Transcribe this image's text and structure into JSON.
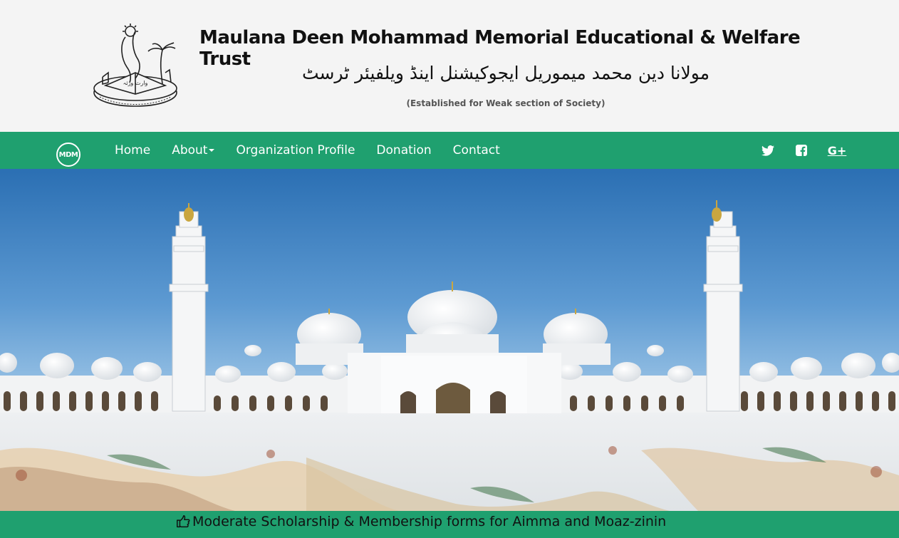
{
  "header": {
    "title": "Maulana Deen Mohammad Memorial Educational & Welfare Trust",
    "urdu_title": "مولانا دین محمد میموریل ایجوکیشنل اینڈ ویلفیئر ٹرسٹ",
    "subtitle": "(Established for Weak section of Society)",
    "logo_text": "وارث ورثہ"
  },
  "navbar": {
    "brand": "MDM",
    "items": [
      {
        "label": "Home"
      },
      {
        "label": "About"
      },
      {
        "label": "Organization Profile"
      },
      {
        "label": "Donation"
      },
      {
        "label": "Contact"
      }
    ],
    "social": [
      "twitter-icon",
      "facebook-icon",
      "google-plus-icon"
    ],
    "google_plus_label": "G+"
  },
  "hero": {
    "image": "mosque-photo"
  },
  "ticker": {
    "text": "Moderate Scholarship & Membership forms for Aimma and Moaz-zinin"
  },
  "colors": {
    "nav_bg": "#1fa06f",
    "header_bg": "#f4f4f4",
    "sky_top": "#2b6fb3",
    "sky_bottom": "#a9cdea"
  }
}
